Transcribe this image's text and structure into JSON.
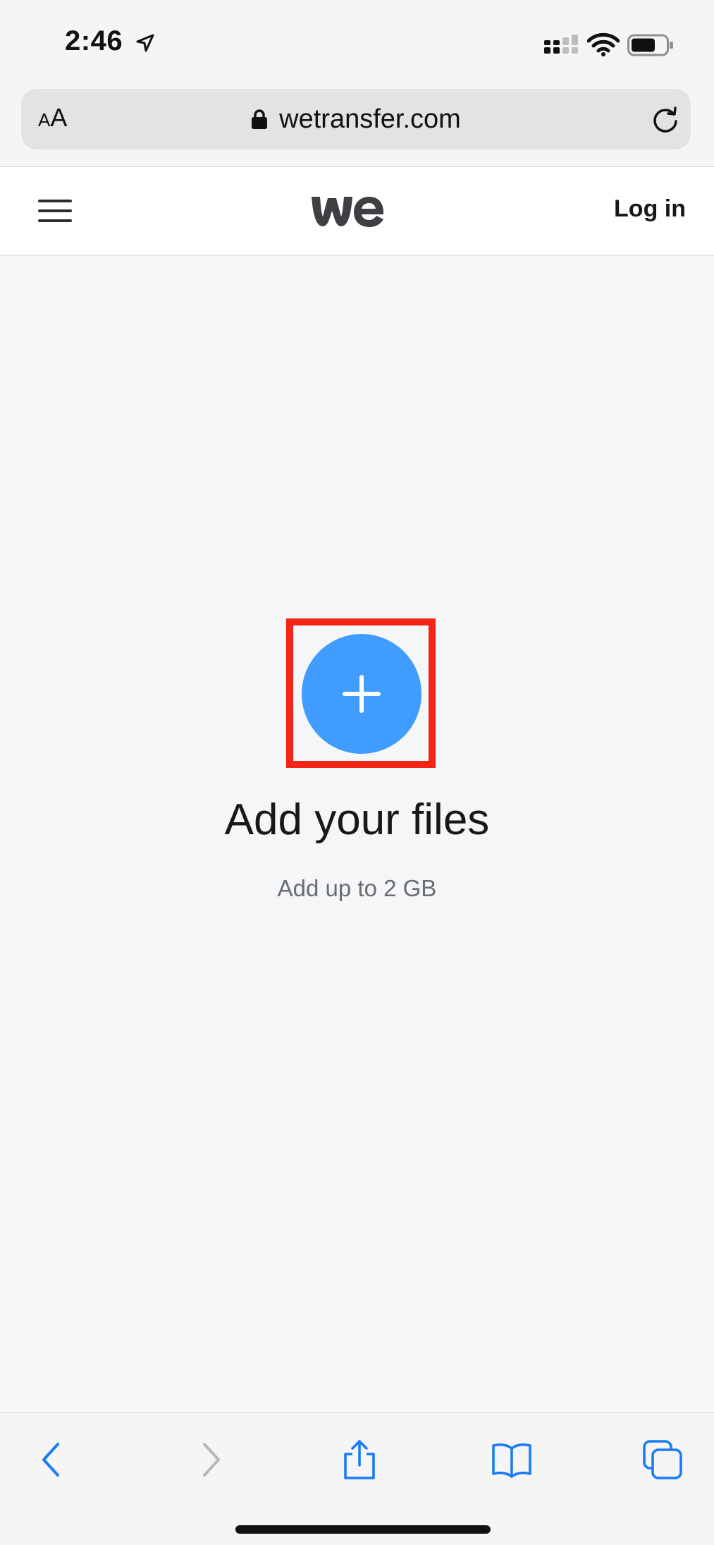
{
  "status_bar": {
    "time": "2:46",
    "icons": [
      "location-arrow-icon",
      "cellular-signal-icon",
      "wifi-icon",
      "battery-icon"
    ]
  },
  "browser": {
    "text_size_small": "A",
    "text_size_large": "A",
    "url": "wetransfer.com",
    "icons": [
      "lock-icon",
      "reload-icon"
    ]
  },
  "header": {
    "login_label": "Log in",
    "icons": [
      "hamburger-menu-icon",
      "wetransfer-logo"
    ]
  },
  "main": {
    "title": "Add your files",
    "subtitle": "Add up to 2 GB",
    "icons": [
      "plus-icon"
    ]
  },
  "toolbar": {
    "icons": [
      "back-icon",
      "forward-icon",
      "share-icon",
      "bookmarks-icon",
      "tabs-icon"
    ]
  },
  "colors": {
    "accent": "#409cff",
    "highlight": "#f42517",
    "safari_blue": "#1a7cf5",
    "disabled_gray": "#b8b8bd",
    "text_dark": "#17181a",
    "text_muted": "#6a6d70",
    "background": "#f4f6f8"
  }
}
